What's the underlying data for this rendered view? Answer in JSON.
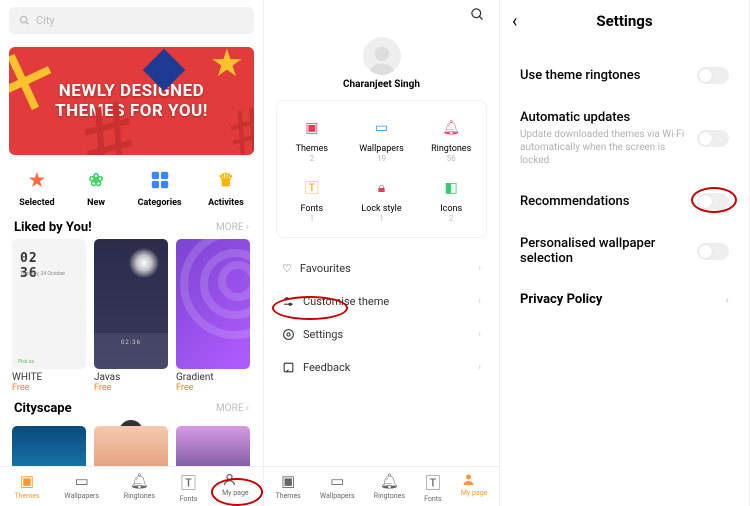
{
  "pane1": {
    "search_placeholder": "City",
    "banner_line1": "NEWLY DESIGNED",
    "banner_line2": "THEMES FOR YOU!",
    "quick": [
      {
        "label": "Selected"
      },
      {
        "label": "New"
      },
      {
        "label": "Categories"
      },
      {
        "label": "Activites"
      }
    ],
    "section1_title": "Liked by You!",
    "more_label": "MORE",
    "themes": [
      {
        "name": "WHITE",
        "price": "Free"
      },
      {
        "name": "Javas",
        "price": "Free"
      },
      {
        "name": "Gradient",
        "price": "Free"
      }
    ],
    "section2_title": "Cityscape",
    "nav": [
      {
        "label": "Themes"
      },
      {
        "label": "Wallpapers"
      },
      {
        "label": "Ringtones"
      },
      {
        "label": "Fonts"
      },
      {
        "label": "My page"
      }
    ]
  },
  "pane2": {
    "username": "Charanjeet Singh",
    "grid": [
      {
        "name": "Themes",
        "count": "2"
      },
      {
        "name": "Wallpapers",
        "count": "19"
      },
      {
        "name": "Ringtones",
        "count": "56"
      },
      {
        "name": "Fonts",
        "count": "1"
      },
      {
        "name": "Lock style",
        "count": "1"
      },
      {
        "name": "Icons",
        "count": "2"
      }
    ],
    "list": [
      {
        "label": "Favourites"
      },
      {
        "label": "Customise theme"
      },
      {
        "label": "Settings"
      },
      {
        "label": "Feedback"
      }
    ],
    "nav": [
      {
        "label": "Themes"
      },
      {
        "label": "Wallpapers"
      },
      {
        "label": "Ringtones"
      },
      {
        "label": "Fonts"
      },
      {
        "label": "My page"
      }
    ]
  },
  "pane3": {
    "title": "Settings",
    "rows": [
      {
        "label": "Use theme ringtones",
        "type": "toggle"
      },
      {
        "label": "Automatic updates",
        "sub": "Update downloaded themes via Wi-Fi automatically when the screen is locked",
        "type": "toggle"
      },
      {
        "label": "Recommendations",
        "type": "toggle"
      },
      {
        "label": "Personalised wallpaper selection",
        "type": "toggle"
      },
      {
        "label": "Privacy Policy",
        "type": "nav"
      }
    ]
  }
}
